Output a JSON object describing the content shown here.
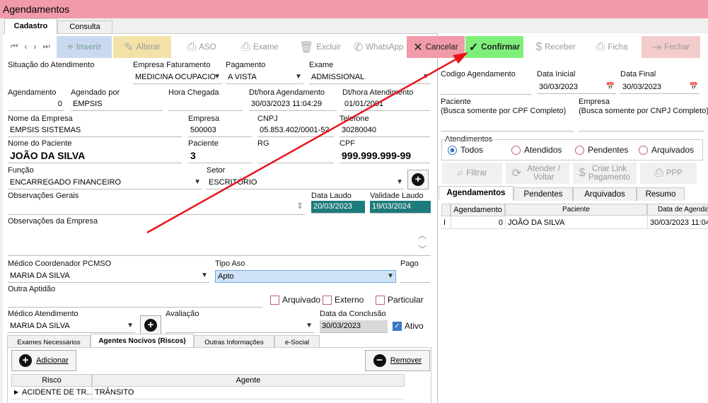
{
  "window": {
    "title": "Agendamentos"
  },
  "tabs": {
    "cadastro": "Cadastro",
    "consulta": "Consulta"
  },
  "toolbar": {
    "inserir": "Inserir",
    "alterar": "Alterar",
    "aso": "ASO",
    "exame": "Exame",
    "excluir": "Excluir",
    "whatsapp": "WhatsApp",
    "cancelar": "Cancelar",
    "confirmar": "Confirmar",
    "receber": "Receber",
    "ficha": "Ficha",
    "fechar": "Fechar"
  },
  "form": {
    "situacao_label": "Situação do Atendimento",
    "empresa_fat_label": "Empresa Faturamento",
    "empresa_fat_value": "MEDICINA OCUPACIO",
    "pagamento_label": "Pagamento",
    "pagamento_value": "A VISTA",
    "exame_label": "Exame",
    "exame_value": "ADMISSIONAL",
    "agendamento_label": "Agendamento",
    "agendamento_value": "0",
    "agendado_por_label": "Agendado por",
    "agendado_por_value": "EMPSIS",
    "hora_chegada_label": "Hora Chegada",
    "dt_agendamento_label": "Dt/hora Agendamento",
    "dt_agendamento_value": "30/03/2023 11:04:29",
    "dt_atendimento_label": "Dt/hora Atendimento",
    "dt_atendimento_value": "01/01/2001",
    "nome_empresa_label": "Nome da Empresa",
    "nome_empresa_value": "EMPSIS SISTEMAS",
    "empresa_label": "Empresa",
    "empresa_value": "500003",
    "cnpj_label": "CNPJ",
    "cnpj_value": "05.853.402/0001-52",
    "telefone_label": "Telefone",
    "telefone_value": "30280040",
    "nome_paciente_label": "Nome do Paciente",
    "nome_paciente_value": "JOÃO DA SILVA",
    "paciente_label": "Paciente",
    "paciente_value": "3",
    "rg_label": "RG",
    "cpf_label": "CPF",
    "cpf_value": "999.999.999-99",
    "funcao_label": "Função",
    "funcao_value": "ENCARREGADO FINANCEIRO",
    "setor_label": "Setor",
    "setor_value": "ESCRITÓRIO",
    "obs_gerais_label": "Observações Gerais",
    "data_laudo_label": "Data Laudo",
    "data_laudo_value": "20/03/2023",
    "validade_laudo_label": "Validade Laudo",
    "validade_laudo_value": "19/03/2024",
    "obs_empresa_label": "Observações da Empresa",
    "medico_coord_label": "Médico Coordenador PCMSO",
    "medico_coord_value": "MARIA DA SILVA",
    "tipo_aso_label": "Tipo Aso",
    "tipo_aso_value": "Apto",
    "pago_label": "Pago",
    "outra_aptidao_label": "Outra Aptidão",
    "arquivado_label": "Arquivado",
    "externo_label": "Externo",
    "particular_label": "Particular",
    "medico_atend_label": "Médico Atendimento",
    "medico_atend_value": "MARIA DA SILVA",
    "avaliacao_label": "Avaliação",
    "data_conclusao_label": "Data da Conclusão",
    "data_conclusao_value": "30/03/2023",
    "ativo_label": "Ativo"
  },
  "subtabs": [
    "Exames Necessários",
    "Agentes Nocivos (Riscos)",
    "Outras Informações",
    "e-Social"
  ],
  "riscos": {
    "adicionar": "Adicionar",
    "remover": "Remover",
    "col_risco": "Risco",
    "col_agente": "Agente",
    "rows": [
      {
        "risco": "ACIDENTE DE TR...",
        "agente": "TRÂNSITO"
      }
    ]
  },
  "right": {
    "codigo_label": "Codigo Agendamento",
    "data_inicial_label": "Data Inicial",
    "data_inicial_value": "30/03/2023",
    "data_final_label": "Data Final",
    "data_final_value": "30/03/2023",
    "paciente_label": "Paciente",
    "paciente_hint": "(Busca somente por CPF Completo)",
    "empresa_label": "Empresa",
    "empresa_hint": "(Busca somente por CNPJ Completo)",
    "atendimentos_label": "Atendimentos",
    "radios": [
      "Todos",
      "Atendidos",
      "Pendentes",
      "Arquivados"
    ],
    "filtrar": "Filtrar",
    "atender_voltar": "Atender / Voltar",
    "criar_link": "Criar Link Pagamento",
    "ppp": "PPP",
    "tabs": [
      "Agendamentos",
      "Pendentes",
      "Arquivados",
      "Resumo"
    ],
    "grid_cols": [
      "Agendamento",
      "Paciente",
      "Data de Agendar"
    ],
    "grid_rows": [
      {
        "marker": "I",
        "agendamento": "0",
        "paciente": "JOÃO DA SILVA",
        "data": "30/03/2023 11:04"
      }
    ]
  }
}
